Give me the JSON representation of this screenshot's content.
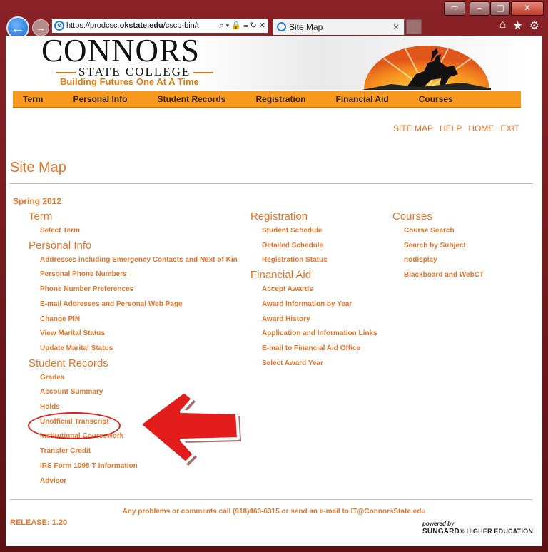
{
  "browser": {
    "url_prefix": "https://prodcsc.",
    "url_host": "okstate.edu",
    "url_rest": "/cscp-bin/t",
    "url_actions": "⌕ ▾ 🔒 ≡ ↻ ✕",
    "tab_title": "Site Map",
    "tab_close": "✕"
  },
  "logo": {
    "name": "CONNORS",
    "sub": "STATE COLLEGE",
    "tagline": "Building Futures One At A Time"
  },
  "menu": [
    "Term",
    "Personal Info",
    "Student Records",
    "Registration",
    "Financial Aid",
    "Courses"
  ],
  "top_links": [
    "SITE MAP",
    "HELP",
    "HOME",
    "EXIT"
  ],
  "page_title": "Site Map",
  "term": "Spring 2012",
  "sections": {
    "term": {
      "title": "Term",
      "links": [
        "Select Term"
      ]
    },
    "personal": {
      "title": "Personal Info",
      "links": [
        "Addresses including Emergency Contacts and Next of Kin",
        "Personal Phone Numbers",
        "Phone Number Preferences",
        "E-mail Addresses and Personal Web Page",
        "Change PIN",
        "View Marital Status",
        "Update Marital Status"
      ]
    },
    "records": {
      "title": "Student Records",
      "links": [
        "Grades",
        "Account Summary",
        "Holds",
        "Unofficial Transcript",
        "Institutional Coursework",
        "Transfer Credit",
        "IRS Form 1098-T Information",
        "Advisor"
      ]
    },
    "registration": {
      "title": "Registration",
      "links": [
        "Student Schedule",
        "Detailed Schedule",
        "Registration Status"
      ]
    },
    "finaid": {
      "title": "Financial Aid",
      "links": [
        "Accept Awards",
        "Award Information by Year",
        "Award History",
        "Application and Information Links",
        "E-mail to Financial Aid Office",
        "Select Award Year"
      ]
    },
    "courses": {
      "title": "Courses",
      "links": [
        "Course Search",
        "Search by Subject",
        "nodisplay",
        "Blackboard and WebCT"
      ]
    }
  },
  "footer": {
    "message": "Any problems or comments call (918)463-6315 or send an e-mail to IT@ConnorsState.edu",
    "release": "RELEASE: 1.20",
    "powered_by": "powered by",
    "sungard": "SUNGARD",
    "sungard_rest": "HIGHER EDUCATION"
  },
  "colors": {
    "accent": "#e8742a",
    "menubar": "#f79a1d",
    "annotation": "#e21b1b"
  }
}
